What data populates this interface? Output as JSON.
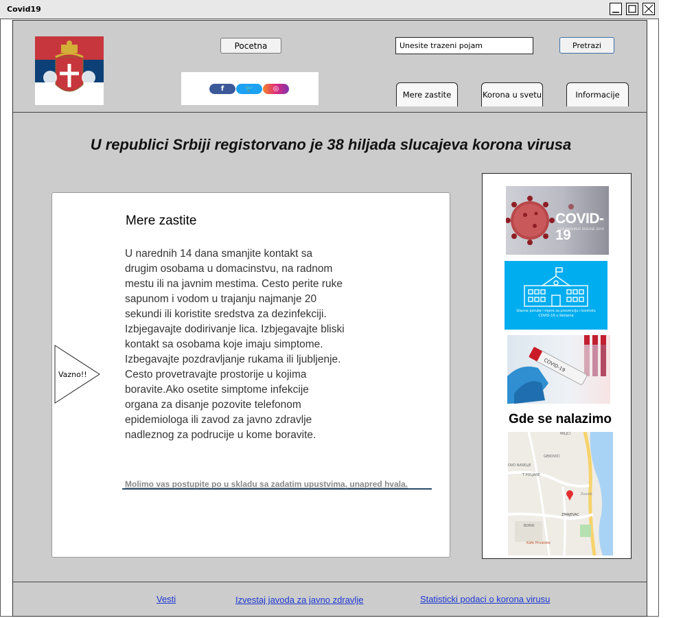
{
  "window": {
    "title": "Covid19"
  },
  "header": {
    "home_button": "Pocetna",
    "search": {
      "value": "Unesite trazeni pojam",
      "button": "Pretrazi"
    },
    "tabs": [
      {
        "label": "Mere zastite"
      },
      {
        "label": "Korona u svetu"
      },
      {
        "label": "Informacije"
      }
    ],
    "social": {
      "facebook": "f",
      "twitter": "🐦",
      "instagram": "◎"
    }
  },
  "main": {
    "headline": "U republici Srbiji registorvano je 38 hiljada slucajeva korona virusa",
    "card": {
      "title": "Mere zastite",
      "body": "U narednih 14 dana smanjite kontakt sa drugim osobama u domacinstvu, na radnom mestu ili na javnim mestima. Cesto perite ruke sapunom i vodom u trajanju najmanje 20 sekundi ili koristite sredstva za dezinfekciji. Izbjegavajte dodirivanje lica. Izbjegavajte bliski kontakt sa osobama koje imaju simptome. Izbegavajte pozdravljanje rukama ili ljubljenje. Cesto provetravajte prostorije u kojima boravite.Ako osetite simptome infekcije organa za disanje pozovite telefonom epidemiologa ili zavod za javno zdravlje nadleznog za podrucije u kome boravite.",
      "link": "Molimo vas postupite po u skladu sa zadatim upustvima, unapred hvala.",
      "callout": "Vazno!!"
    },
    "sidebar": {
      "covid_banner": {
        "title": "COVID-19",
        "subtitle": "CORONAVIRUS DISEASE 2019"
      },
      "school_banner": "Glavne poruke i mjere za prevenciju i kontrolu COVID-19 u školama",
      "test_tube": "COVID-19",
      "location_heading": "Gde se nalazimo",
      "map_labels": [
        "MILJCI",
        "GEKOVIĆI",
        "OVO NASELJE",
        "T POLJANE",
        "Zvonik",
        "ZMAJEVAC",
        "BORIK",
        "Kafe Hrvatske"
      ]
    }
  },
  "footer": {
    "links": [
      "Vesti",
      "Izvestaj javoda za javno zdravlje",
      "Statisticki podaci o korona virusu"
    ]
  },
  "colors": {
    "frame": "#cccccc",
    "link": "#1a36d1",
    "flag_red": "#c6363c",
    "flag_blue": "#0c4076",
    "school_blue": "#00adef"
  }
}
